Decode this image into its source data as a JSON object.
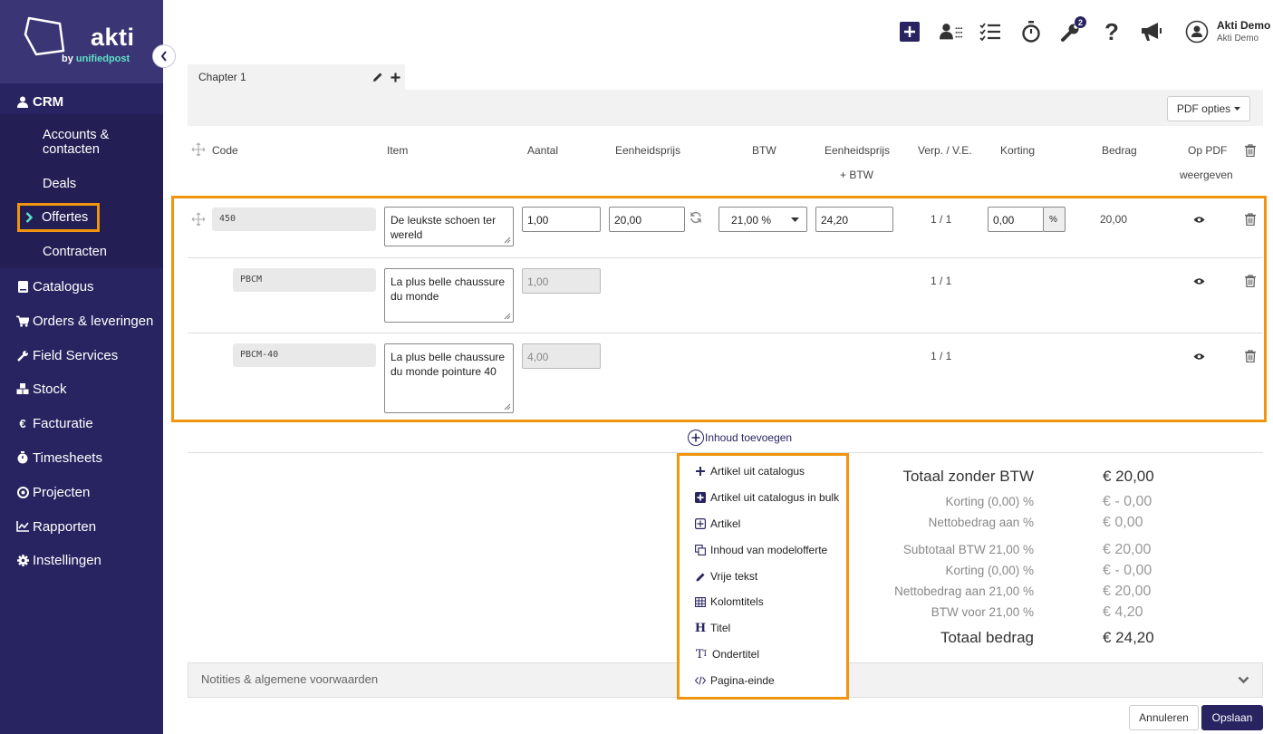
{
  "brand": {
    "name": "akti",
    "sub_prefix": "by ",
    "sub_brand": "unifiedpost"
  },
  "sidebar": {
    "crm": "CRM",
    "crm_items": [
      "Accounts &",
      "contacten",
      "Deals",
      "Offertes",
      "Contracten"
    ],
    "items": [
      "Catalogus",
      "Orders & leveringen",
      "Field Services",
      "Stock",
      "Facturatie",
      "Timesheets",
      "Projecten",
      "Rapporten",
      "Instellingen"
    ]
  },
  "topbar": {
    "notification_count": "2",
    "user_name": "Akti Demo",
    "user_company": "Akti Demo"
  },
  "chapter": {
    "title": "Chapter 1"
  },
  "pdf_options": "PDF opties",
  "columns": {
    "code": "Code",
    "item": "Item",
    "aantal": "Aantal",
    "eenheidsprijs": "Eenheidsprijs",
    "btw": "BTW",
    "eenheidsprijs_btw_1": "Eenheidsprijs",
    "eenheidsprijs_btw_2": "+ BTW",
    "verp": "Verp. / V.E.",
    "korting": "Korting",
    "bedrag": "Bedrag",
    "op_pdf_1": "Op PDF",
    "op_pdf_2": "weergeven"
  },
  "rows": [
    {
      "code": "450",
      "item_1": "De leukste schoen ter",
      "item_2": "wereld",
      "aantal": "1,00",
      "prijs": "20,00",
      "btw": "21,00 %",
      "prijs_btw": "24,20",
      "verp": "1 / 1",
      "korting": "0,00",
      "korting_unit": "%",
      "bedrag": "20,00"
    },
    {
      "code": "PBCM",
      "item_1": "La plus belle chaussure",
      "item_2": "du monde",
      "aantal": "1,00",
      "verp": "1 / 1"
    },
    {
      "code": "PBCM-40",
      "item_1": "La plus belle chaussure",
      "item_2": "du monde pointure 40",
      "aantal": "4,00",
      "verp": "1 / 1"
    }
  ],
  "add_content": "Inhoud toevoegen",
  "menu": [
    "Artikel uit catalogus",
    "Artikel uit catalogus in bulk",
    "Artikel",
    "Inhoud van modelofferte",
    "Vrije tekst",
    "Kolomtitels",
    "Titel",
    "Ondertitel",
    "Pagina-einde"
  ],
  "totals": [
    {
      "label": "Totaal zonder BTW",
      "value": "€ 20,00"
    },
    {
      "label": "Korting (0,00) %",
      "value": "€ - 0,00"
    },
    {
      "label": "Nettobedrag  aan %",
      "value": "€ 0,00"
    },
    {
      "label": "Subtotaal  BTW 21,00 %",
      "value": "€ 20,00"
    },
    {
      "label": "Korting (0,00) %",
      "value": "€ - 0,00"
    },
    {
      "label": "Nettobedrag  aan 21,00 %",
      "value": "€ 20,00"
    },
    {
      "label": "BTW voor 21,00 %",
      "value": "€ 4,20"
    },
    {
      "label": "Totaal bedrag",
      "value": "€ 24,20"
    }
  ],
  "notes": "Notities & algemene voorwaarden",
  "buttons": {
    "cancel": "Annuleren",
    "save": "Opslaan"
  },
  "colors": {
    "sidebar": "#282461",
    "accent": "#f0950d",
    "teal": "#5ee1c6"
  }
}
